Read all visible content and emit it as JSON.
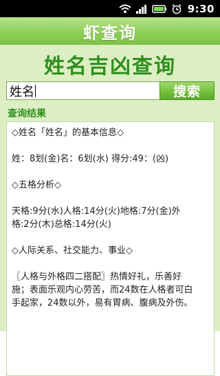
{
  "status": {
    "time": "9:30",
    "icons": [
      "wifi-icon",
      "signal-icon",
      "battery-icon",
      "alarm-icon"
    ]
  },
  "app": {
    "title": "虾查询"
  },
  "main": {
    "heading": "姓名吉凶查询",
    "search": {
      "value": "姓名",
      "button_label": "搜索"
    },
    "section_label": "查询结果",
    "results": {
      "l1": "◇姓名「姓名」的基本信息◇",
      "l2": "姓：8划(金)名：6划(水) 得分:49：(凶)",
      "l3": "◇五格分析◇",
      "l4a": "天格:9分(水)人格:14分(火)地格:7分(金)外",
      "l4b": "格:2分(木)总格:14分(火)",
      "l5": "◇人际关系、社交能力、事业◇",
      "l6a": "〖人格与外格四二搭配〗热情好礼，乐善好",
      "l6b": "施；表面乐观内心劳苦，而24数在人格者可白",
      "l6c": "手起家，24数以外，易有胃病、腹病及外伤。"
    }
  }
}
